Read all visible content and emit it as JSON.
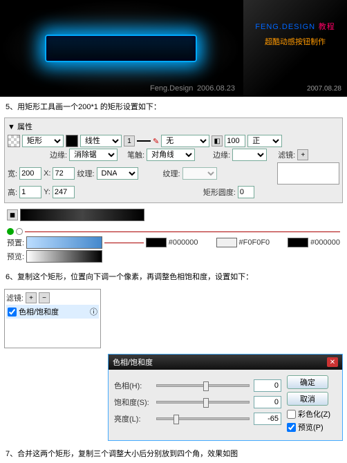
{
  "banner": {
    "left_sig": "Feng.Design",
    "left_date": "2006.08.23",
    "right_title_a": "FENG.DESIGN",
    "right_title_b": "教程",
    "right_sub": "超酷动感按钮制作",
    "right_date": "2007.08.28"
  },
  "steps": {
    "s5": "5、用矩形工具画一个200*1 的矩形设置如下：",
    "s6": "6、复制这个矩形，位置向下调一个像素，再调整色相饱和度，设置如下：",
    "s7": "7、合并这两个矩形，复制三个调整大小后分别放到四个角，效果如图"
  },
  "prop": {
    "title": "▼ 属性",
    "shape_label": "矩形",
    "edge_label": "边缘:",
    "edge_value": "消除锯齿",
    "tex_label": "纹理:",
    "tex_value": "DNA",
    "stroke_kind": "线性",
    "stroke_style_lbl": "笔触:",
    "stroke_style": "对角线 1",
    "tip_value": "无",
    "w_lbl": "宽:",
    "w_val": "200",
    "h_lbl": "高:",
    "h_val": "1",
    "x_lbl": "X:",
    "x_val": "72",
    "y_lbl": "Y:",
    "y_val": "247",
    "edge2_lbl": "边缘:",
    "rect_round_lbl": "矩形圆度:",
    "rect_round_val": "0",
    "filter_lbl": "滤镜:",
    "opacity_val": "100",
    "blend_val": "正常",
    "plus": "+",
    "preset_lbl": "预置:",
    "preview_lbl": "预览:",
    "hex1": "#000000",
    "hex2": "#F0F0F0",
    "hex3": "#000000"
  },
  "filter": {
    "lbl": "滤镜:",
    "item": "色相/饱和度"
  },
  "hsl": {
    "title": "色相/饱和度",
    "hue_lbl": "色相(H):",
    "hue_val": "0",
    "sat_lbl": "饱和度(S):",
    "sat_val": "0",
    "lit_lbl": "亮度(L):",
    "lit_val": "-65",
    "ok": "确定",
    "cancel": "取消",
    "colorize": "彩色化(Z)",
    "preview": "预览(P)"
  }
}
